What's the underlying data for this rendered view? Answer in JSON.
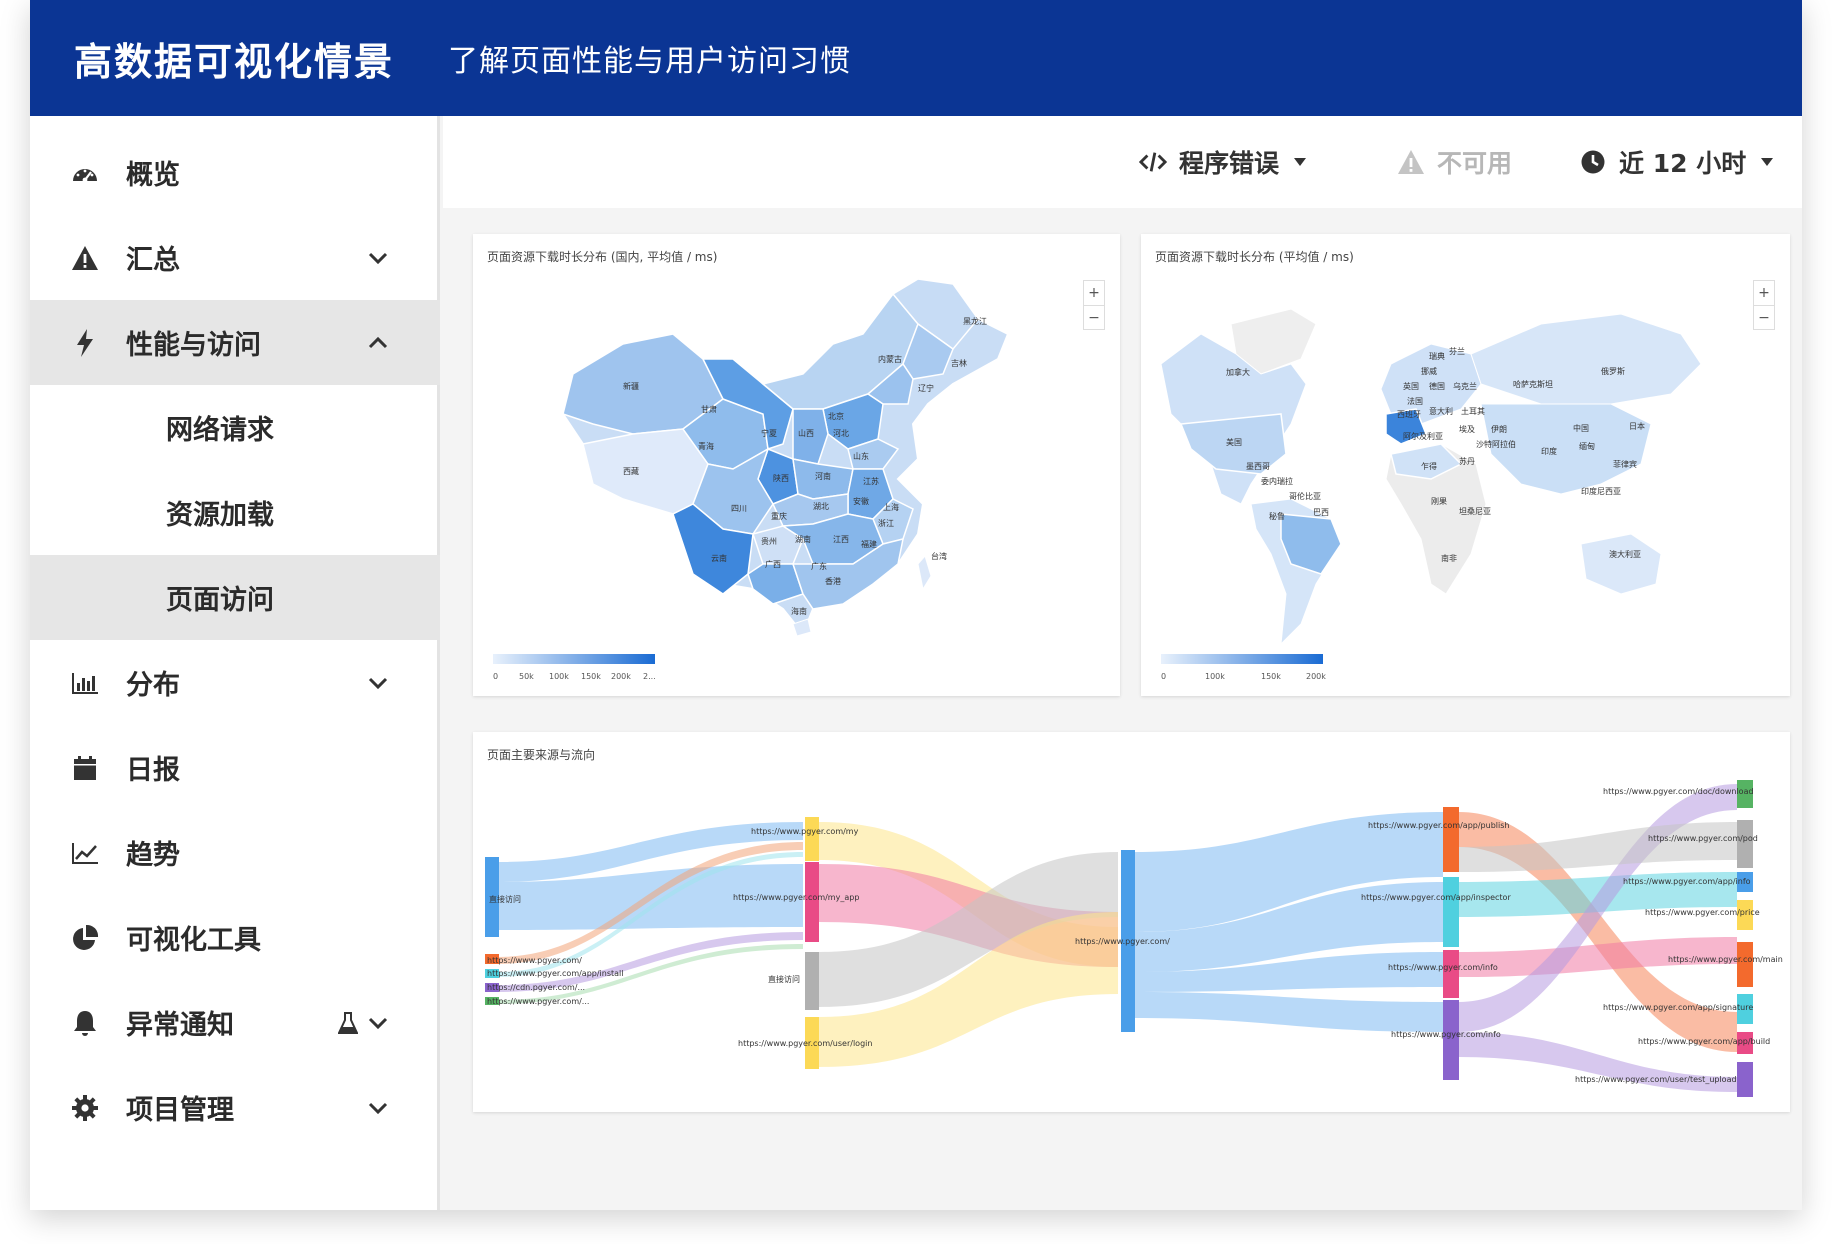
{
  "header": {
    "title": "高数据可视化情景",
    "subtitle": "了解页面性能与用户访问习惯"
  },
  "sidebar": {
    "items": [
      {
        "label": "概览",
        "icon": "dashboard-icon"
      },
      {
        "label": "汇总",
        "icon": "warning-icon",
        "expandable": true,
        "expanded": false
      },
      {
        "label": "性能与访问",
        "icon": "lightning-icon",
        "expandable": true,
        "expanded": true
      },
      {
        "label": "网络请求",
        "sub": true
      },
      {
        "label": "资源加载",
        "sub": true
      },
      {
        "label": "页面访问",
        "sub": true,
        "selected": true
      },
      {
        "label": "分布",
        "icon": "bar-chart-icon",
        "expandable": true,
        "expanded": false
      },
      {
        "label": "日报",
        "icon": "calendar-icon"
      },
      {
        "label": "趋势",
        "icon": "line-chart-icon"
      },
      {
        "label": "可视化工具",
        "icon": "pie-chart-icon"
      },
      {
        "label": "异常通知",
        "icon": "bell-icon",
        "expandable": true,
        "beta": true
      },
      {
        "label": "项目管理",
        "icon": "gear-icon",
        "expandable": true
      }
    ]
  },
  "toolbar": {
    "error_filter": "程序错误",
    "availability": "不可用",
    "time_range": "近 12 小时"
  },
  "map_china": {
    "title": "页面资源下载时长分布 (国内, 平均值 / ms)",
    "legend_ticks": [
      "0",
      "50k",
      "100k",
      "150k",
      "200k",
      "2..."
    ],
    "regions": [
      {
        "name": "黑龙江"
      },
      {
        "name": "吉林"
      },
      {
        "name": "辽宁"
      },
      {
        "name": "内蒙古"
      },
      {
        "name": "新疆"
      },
      {
        "name": "西藏"
      },
      {
        "name": "青海"
      },
      {
        "name": "甘肃"
      },
      {
        "name": "宁夏"
      },
      {
        "name": "山西"
      },
      {
        "name": "北京"
      },
      {
        "name": "河北"
      },
      {
        "name": "山东"
      },
      {
        "name": "河南"
      },
      {
        "name": "江苏"
      },
      {
        "name": "陕西"
      },
      {
        "name": "安徽"
      },
      {
        "name": "湖北"
      },
      {
        "name": "上海"
      },
      {
        "name": "四川"
      },
      {
        "name": "重庆"
      },
      {
        "name": "浙江"
      },
      {
        "name": "贵州"
      },
      {
        "name": "湖南"
      },
      {
        "name": "江西"
      },
      {
        "name": "云南"
      },
      {
        "name": "广西"
      },
      {
        "name": "广东"
      },
      {
        "name": "福建"
      },
      {
        "name": "台湾"
      },
      {
        "name": "香港"
      },
      {
        "name": "海南"
      }
    ]
  },
  "map_world": {
    "title": "页面资源下载时长分布 (平均值 / ms)",
    "legend_ticks": [
      "0",
      "100k",
      "150k",
      "200k"
    ],
    "regions": [
      {
        "name": "加拿大"
      },
      {
        "name": "美国"
      },
      {
        "name": "墨西哥"
      },
      {
        "name": "哥伦比亚"
      },
      {
        "name": "委内瑞拉"
      },
      {
        "name": "秘鲁"
      },
      {
        "name": "巴西"
      },
      {
        "name": "挪威"
      },
      {
        "name": "瑞典"
      },
      {
        "name": "芬兰"
      },
      {
        "name": "英国"
      },
      {
        "name": "法国"
      },
      {
        "name": "德国"
      },
      {
        "name": "乌克兰"
      },
      {
        "name": "哈萨克斯坦"
      },
      {
        "name": "西班牙"
      },
      {
        "name": "意大利"
      },
      {
        "name": "土耳其"
      },
      {
        "name": "伊朗"
      },
      {
        "name": "阿尔及利亚"
      },
      {
        "name": "埃及"
      },
      {
        "name": "沙特阿拉伯"
      },
      {
        "name": "印度"
      },
      {
        "name": "中国"
      },
      {
        "name": "俄罗斯"
      },
      {
        "name": "日本"
      },
      {
        "name": "缅甸"
      },
      {
        "name": "菲律宾"
      },
      {
        "name": "印度尼西亚"
      },
      {
        "name": "澳大利亚"
      },
      {
        "name": "乍得"
      },
      {
        "name": "苏丹"
      },
      {
        "name": "刚果"
      },
      {
        "name": "坦桑尼亚"
      },
      {
        "name": "南非"
      }
    ]
  },
  "sankey": {
    "title": "页面主要来源与流向",
    "nodes": [
      "直接访问",
      "https://www.pgyer.com/",
      "https://www.pgyer.com/app/install",
      "https://cdn.pgyer.com/...",
      "https://www.pgyer.com/...",
      "https://www.pgyer.com/my",
      "https://www.pgyer.com/my_app",
      "直接访问",
      "https://www.pgyer.com/user/login",
      "https://www.pgyer.com/",
      "https://www.pgyer.com/app/publish",
      "https://www.pgyer.com/app/inspector",
      "https://www.pgyer.com/info",
      "https://www.pgyer.com/info",
      "https://www.pgyer.com/doc/download",
      "https://www.pgyer.com/pod",
      "https://www.pgyer.com/app/info",
      "https://www.pgyer.com/price",
      "https://www.pgyer.com/main",
      "https://www.pgyer.com/app/signature",
      "https://www.pgyer.com/app/build",
      "https://www.pgyer.com/user/test_upload"
    ]
  }
}
